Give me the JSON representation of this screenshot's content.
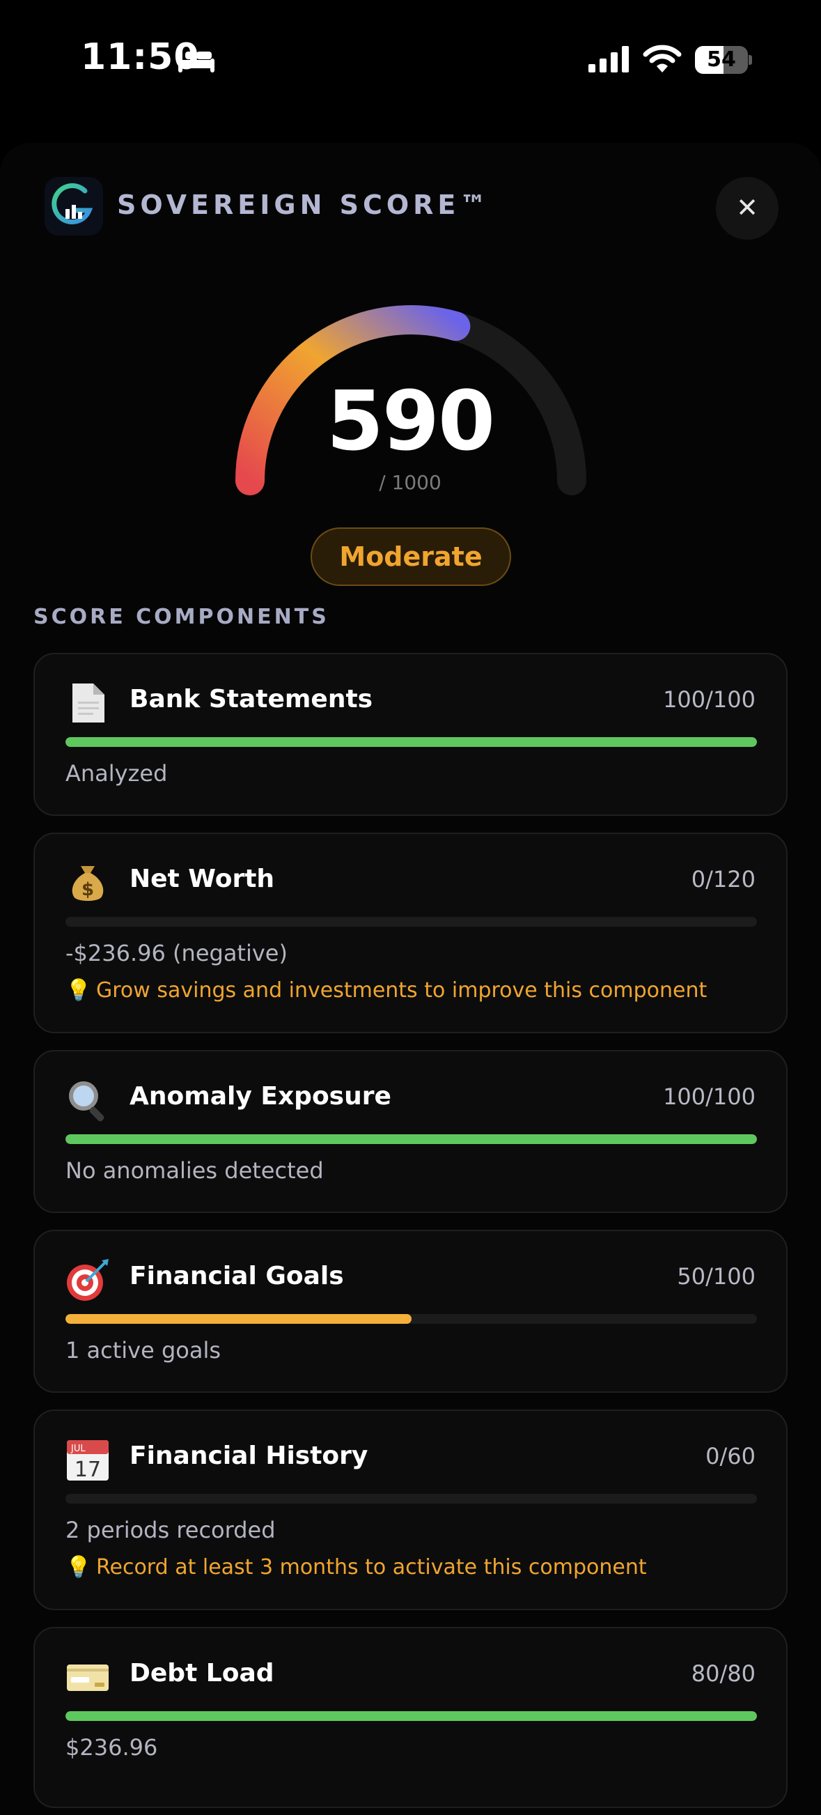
{
  "status_bar": {
    "time": "11:50",
    "battery": "54",
    "battery_level": 0.54
  },
  "header": {
    "title": "SOVEREIGN SCORE™",
    "close_glyph": "✕"
  },
  "score": {
    "value": "590",
    "max": "/ 1000",
    "fraction": 0.59,
    "rating": "Moderate"
  },
  "section_label": "SCORE COMPONENTS",
  "components": [
    {
      "title": "Bank Statements",
      "score": "100/100",
      "progress": 1.0,
      "detail": "Analyzed",
      "icon": "document-icon"
    },
    {
      "title": "Net Worth",
      "score": "0/120",
      "progress": 0.0,
      "detail": "-$236.96 (negative)",
      "tip": "Grow savings and investments to improve this component",
      "tip_icon": "💡",
      "icon": "money-bag-icon"
    },
    {
      "title": "Anomaly Exposure",
      "score": "100/100",
      "progress": 1.0,
      "detail": "No anomalies detected",
      "icon": "magnifier-icon"
    },
    {
      "title": "Financial Goals",
      "score": "50/100",
      "progress": 0.5,
      "detail": "1 active goals",
      "icon": "target-icon"
    },
    {
      "title": "Financial History",
      "score": "0/60",
      "progress": 0.0,
      "detail": "2 periods recorded",
      "tip": "Record at least 3 months to activate this component",
      "tip_icon": "💡",
      "calendar_month": "JUL",
      "calendar_day": "17",
      "icon": "calendar-icon"
    },
    {
      "title": "Debt Load",
      "score": "80/80",
      "progress": 1.0,
      "detail": "$236.96",
      "icon": "credit-card-icon"
    }
  ],
  "colors": {
    "progress_full": "#5ec85e",
    "progress_partial": "#f4b03a",
    "accent_orange": "#f0a530",
    "gauge_start": "#e5484d",
    "gauge_mid": "#f0a530",
    "gauge_end": "#6b63e8"
  }
}
